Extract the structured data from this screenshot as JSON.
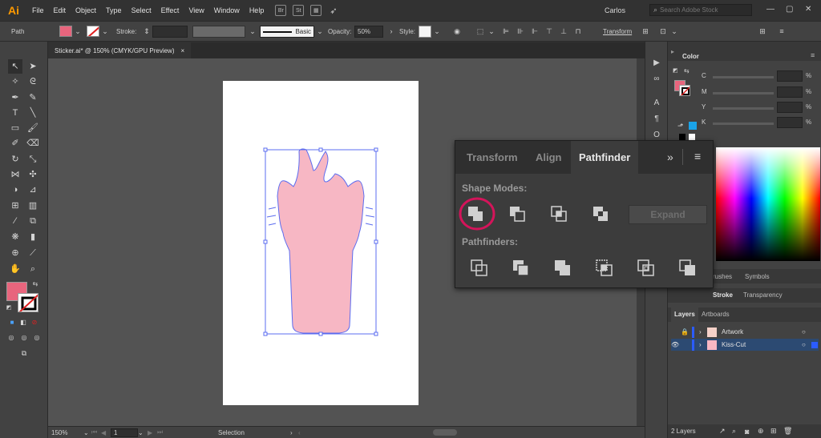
{
  "app": {
    "logo": "Ai",
    "menus": [
      "File",
      "Edit",
      "Object",
      "Type",
      "Select",
      "Effect",
      "View",
      "Window",
      "Help"
    ],
    "user": "Carlos",
    "search_placeholder": "Search Adobe Stock",
    "menu_icons": [
      "Br",
      "St"
    ]
  },
  "control_bar": {
    "object_type": "Path",
    "fill_color": "#e8657d",
    "stroke_label": "Stroke:",
    "brush_style": "Basic",
    "opacity_label": "Opacity:",
    "opacity_value": "50%",
    "style_label": "Style:",
    "transform_label": "Transform"
  },
  "document": {
    "tab_title": "Sticker.ai* @ 150% (CMYK/GPU Preview)",
    "close_glyph": "×"
  },
  "status": {
    "zoom": "150%",
    "artboard_number": "1",
    "tool_name": "Selection"
  },
  "artwork": {
    "fill_color": "#f7b7c4",
    "selection_color": "#5b6cf0"
  },
  "color_panel": {
    "tab_title": "Color",
    "channels": [
      "C",
      "M",
      "Y",
      "K"
    ],
    "pct_symbol": "%",
    "fill_color": "#e8657d"
  },
  "mid_tabs": {
    "brushes": "rushes",
    "symbols": "Symbols",
    "stroke": "Stroke",
    "transparency": "Transparency"
  },
  "layers_panel": {
    "tabs": [
      "Layers",
      "Artboards"
    ],
    "layers": [
      {
        "name": "Artwork",
        "locked": true,
        "visible": false
      },
      {
        "name": "Kiss-Cut",
        "locked": false,
        "visible": true
      }
    ],
    "count_label": "2 Layers"
  },
  "pathfinder_panel": {
    "tabs": [
      "Transform",
      "Align",
      "Pathfinder"
    ],
    "active_tab": "Pathfinder",
    "shape_modes_label": "Shape Modes:",
    "pathfinders_label": "Pathfinders:",
    "expand_label": "Expand",
    "highlight_color": "#d4145a",
    "more_glyph": "»",
    "menu_glyph": "≡"
  }
}
